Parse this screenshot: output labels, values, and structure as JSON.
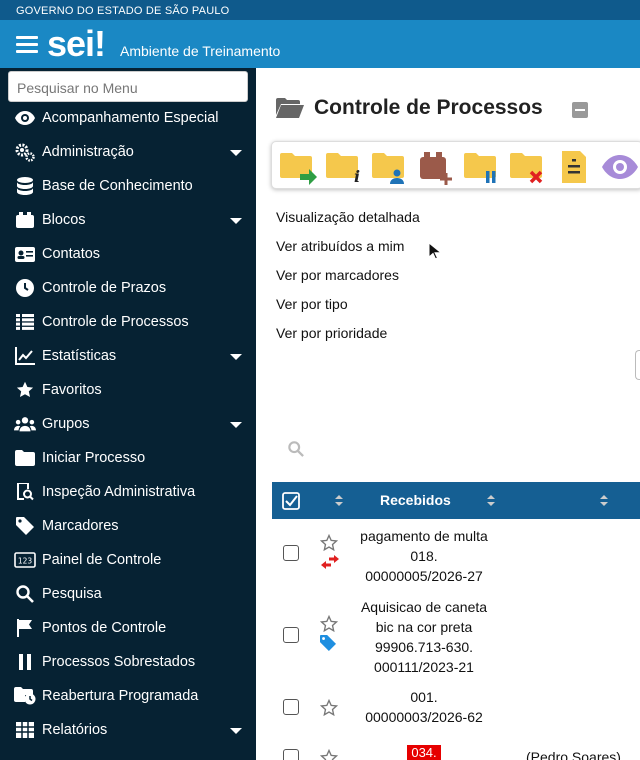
{
  "gov_bar": {
    "text": "GOVERNO DO ESTADO DE SÃO PAULO"
  },
  "header": {
    "logo": "sei",
    "environment": "Ambiente de Treinamento"
  },
  "sidebar": {
    "search_placeholder": "Pesquisar no Menu",
    "items": [
      {
        "label": "Acompanhamento Especial",
        "icon": "eye-icon",
        "has_submenu": false
      },
      {
        "label": "Administração",
        "icon": "gears-icon",
        "has_submenu": true
      },
      {
        "label": "Base de Conhecimento",
        "icon": "database-icon",
        "has_submenu": false
      },
      {
        "label": "Blocos",
        "icon": "blocks-icon",
        "has_submenu": true
      },
      {
        "label": "Contatos",
        "icon": "contact-card-icon",
        "has_submenu": false
      },
      {
        "label": "Controle de Prazos",
        "icon": "clock-icon",
        "has_submenu": false
      },
      {
        "label": "Controle de Processos",
        "icon": "list-icon",
        "has_submenu": false
      },
      {
        "label": "Estatísticas",
        "icon": "chart-line-icon",
        "has_submenu": true
      },
      {
        "label": "Favoritos",
        "icon": "star-icon",
        "has_submenu": false
      },
      {
        "label": "Grupos",
        "icon": "users-icon",
        "has_submenu": true
      },
      {
        "label": "Iniciar Processo",
        "icon": "folder-icon",
        "has_submenu": false
      },
      {
        "label": "Inspeção Administrativa",
        "icon": "inspect-icon",
        "has_submenu": false
      },
      {
        "label": "Marcadores",
        "icon": "tag-icon",
        "has_submenu": false
      },
      {
        "label": "Painel de Controle",
        "icon": "panel-123-icon",
        "has_submenu": false
      },
      {
        "label": "Pesquisa",
        "icon": "search-icon",
        "has_submenu": false
      },
      {
        "label": "Pontos de Controle",
        "icon": "flag-icon",
        "has_submenu": false
      },
      {
        "label": "Processos Sobrestados",
        "icon": "pause-icon",
        "has_submenu": false
      },
      {
        "label": "Reabertura Programada",
        "icon": "folder-clock-icon",
        "has_submenu": false
      },
      {
        "label": "Relatórios",
        "icon": "table-icon",
        "has_submenu": true
      }
    ]
  },
  "main": {
    "title": "Controle de Processos",
    "views": [
      "Visualização detalhada",
      "Ver atribuídos a mim",
      "Ver por marcadores",
      "Ver por tipo",
      "Ver por prioridade"
    ],
    "table": {
      "header": "Recebidos",
      "rows": [
        {
          "lines": [
            "pagamento de multa",
            "018.",
            "00000005/2026-27"
          ],
          "sub_icon": "transfer-arrows-icon"
        },
        {
          "lines": [
            "Aquisicao de caneta",
            "bic na cor preta",
            "99906.713-630.",
            "000111/2023-21"
          ],
          "sub_icon": "tag-icon"
        },
        {
          "lines": [
            "001.",
            "00000003/2026-62"
          ],
          "sub_icon": ""
        },
        {
          "lines": [
            "034."
          ],
          "owner": "(Pedro Soares)"
        }
      ]
    }
  },
  "colors": {
    "gov_bar": "#0f5a8c",
    "header": "#1a88c4",
    "sidebar": "#062233",
    "table_header": "#155f93",
    "folder": "#f5c84c"
  }
}
